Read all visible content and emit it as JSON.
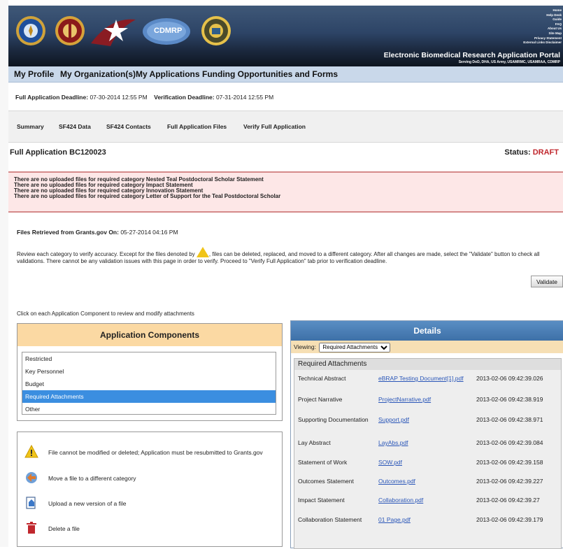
{
  "header": {
    "top_links": [
      "Home",
      "Help Desk",
      "Guide",
      "FAQ",
      "About Us",
      "Site Map",
      "Privacy Statement",
      "External Links Disclaimer"
    ],
    "portal_title": "Electronic Biomedical Research Application Portal",
    "portal_subtitle": "Serving DoD, DHA, US Army, USAMRMC, USAMRAA, CDMRP",
    "logo_cdmrp": "CDMRP"
  },
  "main_nav": [
    "My Profile",
    "My Organization(s)",
    "My Applications",
    "Funding Opportunities and Forms"
  ],
  "deadlines": {
    "full_label": "Full Application Deadline:",
    "full_value": "07-30-2014 12:55 PM",
    "verify_label": "Verification Deadline:",
    "verify_value": "07-31-2014 12:55 PM"
  },
  "sub_tabs": [
    "Summary",
    "SF424 Data",
    "SF424 Contacts",
    "Full Application Files",
    "Verify Full Application"
  ],
  "application": {
    "title": "Full Application BC120023",
    "status_label": "Status:",
    "status_value": "DRAFT"
  },
  "errors": [
    "There are no uploaded files for required category Nested Teal Postdoctoral Scholar Statement",
    "There are no uploaded files for required category Impact Statement",
    "There are no uploaded files for required category Innovation Statement",
    "There are no uploaded files for required category Letter of Support for the Teal Postdoctoral Scholar"
  ],
  "retrieved": {
    "label": "Files Retrieved from Grants.gov On:",
    "value": "05-27-2014 04:16 PM"
  },
  "instructions": {
    "part1": "Review each category to verify accuracy. Except for the files denoted by",
    "part2": ", files can be deleted, replaced, and moved to a different category. After all changes are made, select the \"Validate\" button to check all validations. There cannot be any validation issues with this page in order to verify. Proceed to \"Verify Full Application\" tab prior to verification deadline."
  },
  "validate_label": "Validate",
  "click_instruction": "Click on each Application Component to review and modify attachments",
  "components": {
    "title": "Application Components",
    "items": [
      "Restricted",
      "Key Personnel",
      "Budget",
      "Required Attachments",
      "Other"
    ],
    "selected": "Required Attachments"
  },
  "legend": [
    {
      "icon": "warning-icon",
      "text": "File cannot be modified or deleted; Application must be resubmitted to Grants.gov"
    },
    {
      "icon": "move-icon",
      "text": "Move a file to a different category"
    },
    {
      "icon": "upload-icon",
      "text": "Upload a new version of a file"
    },
    {
      "icon": "trash-icon",
      "text": "Delete a file"
    }
  ],
  "details": {
    "title": "Details",
    "viewing_label": "Viewing:",
    "viewing_value": "Required Attachments",
    "section_title": "Required Attachments",
    "rows": [
      {
        "category": "Technical Abstract",
        "file": "eBRAP Testing Document[1].pdf",
        "timestamp": "2013-02-06 09:42:39.026"
      },
      {
        "category": "Project Narrative",
        "file": "ProjectNarrative.pdf",
        "timestamp": "2013-02-06 09:42:38.919"
      },
      {
        "category": "Supporting Documentation",
        "file": "Support.pdf",
        "timestamp": "2013-02-06 09:42:38.971"
      },
      {
        "category": "Lay Abstract",
        "file": "LayAbs.pdf",
        "timestamp": "2013-02-06 09:42:39.084"
      },
      {
        "category": "Statement of Work",
        "file": "SOW.pdf",
        "timestamp": "2013-02-06 09:42:39.158"
      },
      {
        "category": "Outcomes Statement",
        "file": "Outcomes.pdf",
        "timestamp": "2013-02-06 09:42:39.227"
      },
      {
        "category": "Impact Statement",
        "file": "Collaboration.pdf",
        "timestamp": "2013-02-06 09:42:39.27"
      },
      {
        "category": "Collaboration Statement",
        "file": "01 Page.pdf",
        "timestamp": "2013-02-06 09:42:39.179"
      }
    ]
  },
  "colors": {
    "status_draft": "#c0272d",
    "selected_item": "#3b8ee0",
    "link": "#2a56b8",
    "components_header": "#fbd9a3",
    "details_header": "#4a7fb8"
  }
}
